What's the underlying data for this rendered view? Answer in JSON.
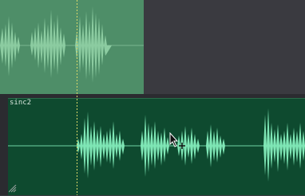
{
  "tracks": [
    {
      "clip_name": "",
      "color": "#4e8e68",
      "wave_color": "#86c69c"
    },
    {
      "clip_name": "sinc2",
      "color": "#0e4a2f",
      "wave_color": "#7fe7b6"
    }
  ],
  "playhead": {
    "color": "#d9d86a"
  },
  "icons": {
    "cursor": "arrow-with-crosshair-icon",
    "resize": "resize-grip-icon"
  }
}
